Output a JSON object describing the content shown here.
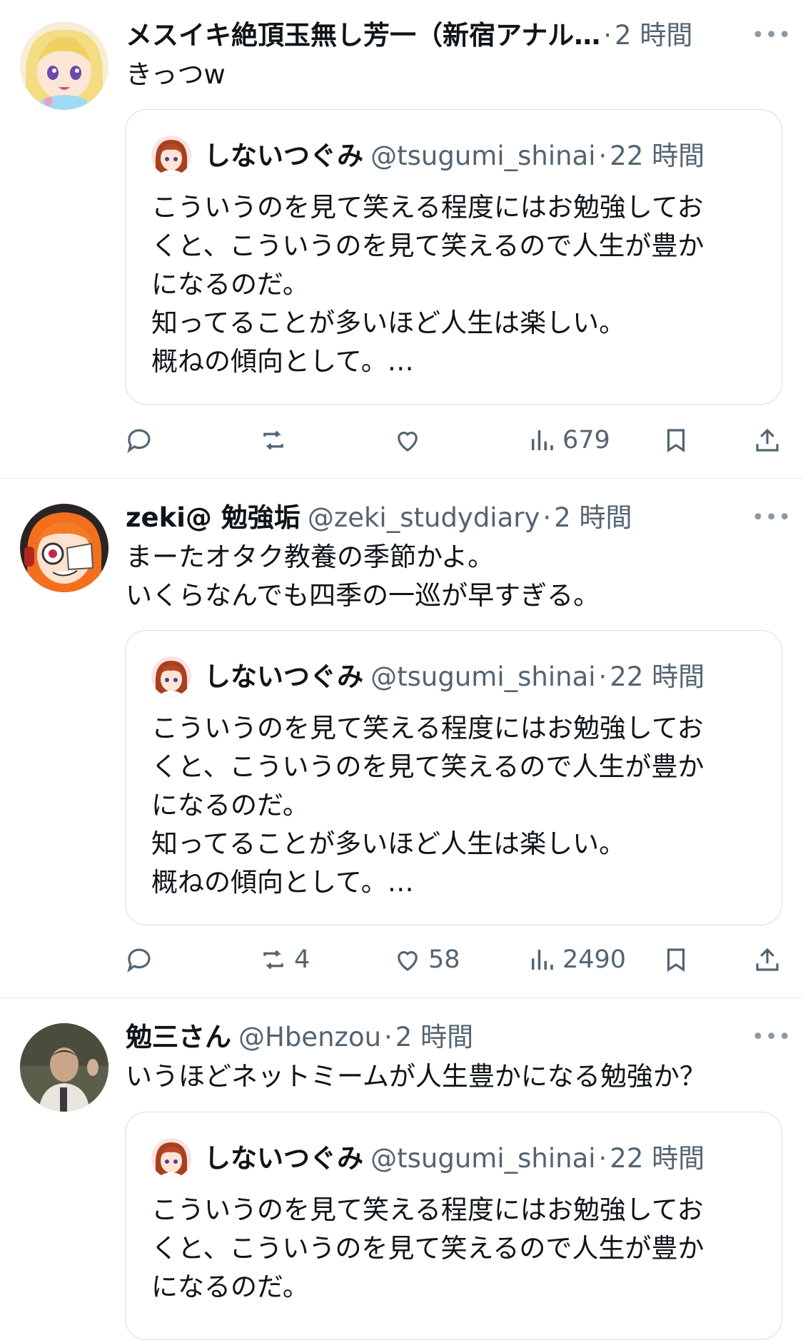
{
  "quoted": {
    "name": "しないつぐみ",
    "handle": "@tsugumi_shinai",
    "time": "22 時間",
    "text": "こういうのを見て笑える程度にはお勉強してお\nくと、こういうのを見て笑えるので人生が豊か\nになるのだ。\n知ってることが多いほど人生は楽しい。\n概ねの傾向として。…",
    "text_short": "こういうのを見て笑える程度にはお勉強してお\nくと、こういうのを見て笑えるので人生が豊か\nになるのだ。"
  },
  "tweets": [
    {
      "name": "メスイキ絶頂玉無し芳一（新宿アナル…",
      "handle": "",
      "time": "2 時間",
      "text": "きっつw",
      "replies": "",
      "retweets": "",
      "likes": "",
      "views": "679"
    },
    {
      "name": "zeki@ 勉強垢",
      "handle": "@zeki_studydiary",
      "time": "2 時間",
      "text": "まーたオタク教養の季節かよ。\nいくらなんでも四季の一巡が早すぎる。",
      "replies": "",
      "retweets": "4",
      "likes": "58",
      "views": "2490"
    },
    {
      "name": "勉三さん",
      "handle": "@Hbenzou",
      "time": "2 時間",
      "text": "いうほどネットミームが人生豊かになる勉強か？"
    }
  ],
  "more_glyph": "•••",
  "dot": "·",
  "icons": [
    "reply-icon",
    "retweet-icon",
    "like-icon",
    "views-icon",
    "bookmark-icon",
    "share-icon"
  ],
  "colors": {
    "text": "#0f1419",
    "muted": "#536471",
    "border": "#d7dde2"
  }
}
